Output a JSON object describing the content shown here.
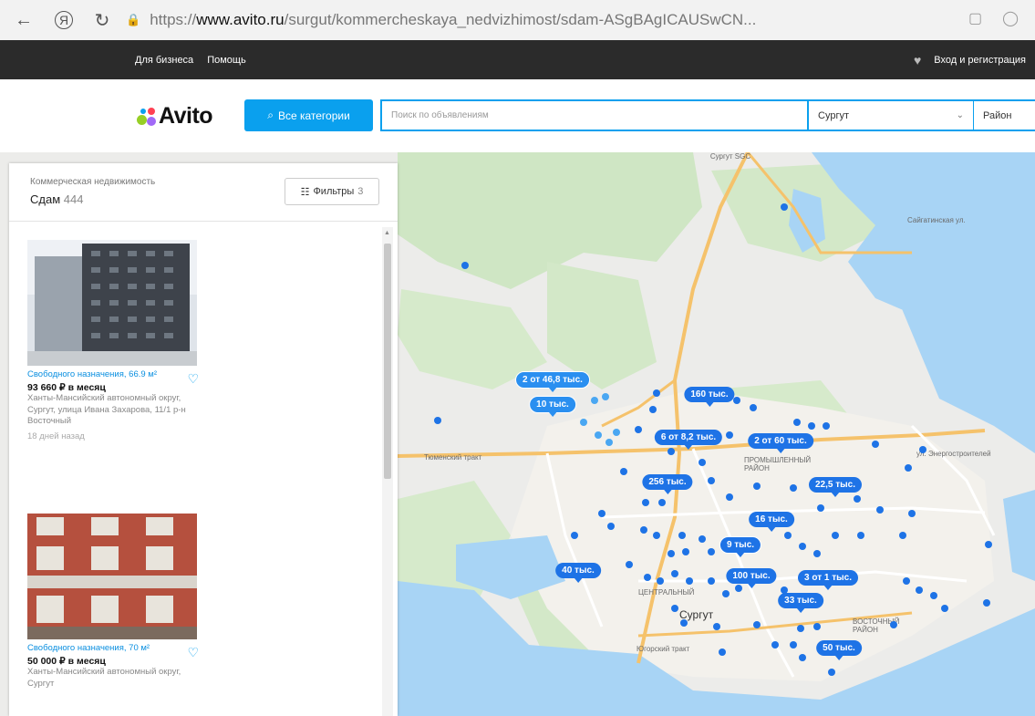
{
  "browser": {
    "url_prefix": "https://",
    "url_host": "www.avito.ru",
    "url_path": "/surgut/kommercheskaya_nedvizhimost/sdam-ASgBAgICAUSwCN..."
  },
  "topbar": {
    "business": "Для бизнеса",
    "help": "Помощь",
    "login": "Вход и регистрация"
  },
  "header": {
    "logo": "Avito",
    "categories_button": "Все категории",
    "search_placeholder": "Поиск по объявлениям",
    "city": "Сургут",
    "district": "Район"
  },
  "panel": {
    "category": "Коммерческая недвижимость",
    "deal": "Сдам",
    "count": "444",
    "filters_label": "Фильтры",
    "filters_count": "3",
    "listings": [
      {
        "title": "Свободного назначения, 66.9 м²",
        "price": "93 660 ₽ в месяц",
        "address": "Ханты-Мансийский автономный округ, Сургут, улица Ивана Захарова, 11/1 р-н Восточный",
        "date": "18 дней назад"
      },
      {
        "title": "Свободного назначения, 70 м²",
        "price": "50 000 ₽ в месяц",
        "address": "Ханты-Мансийский автономный округ, Сургут"
      }
    ]
  },
  "map": {
    "labels": {
      "airport": "Сургут SGC",
      "road_tyumen": "Тюменский тракт",
      "street_east": "ул. Энергостроителей",
      "city_label": "Сургут",
      "district_center": "ЦЕНТРАЛЬНЫЙ",
      "district_industrial": "ПРОМЫШЛЕННЫЙ РАЙОН",
      "district_east": "ВОСТОЧНЫЙ РАЙОН",
      "river_road": "Югорский тракт",
      "top_right_road": "Сайгатинская ул."
    },
    "pins": [
      {
        "label": "2 от 46,8 тыс."
      },
      {
        "label": "10 тыс."
      },
      {
        "label": "160 тыс."
      },
      {
        "label": "6 от 8,2 тыс."
      },
      {
        "label": "2 от 60 тыс."
      },
      {
        "label": "256 тыс."
      },
      {
        "label": "22,5 тыс."
      },
      {
        "label": "16 тыс."
      },
      {
        "label": "9 тыс."
      },
      {
        "label": "40 тыс."
      },
      {
        "label": "100 тыс."
      },
      {
        "label": "3 от 1 тыс."
      },
      {
        "label": "33 тыс."
      },
      {
        "label": "50 тыс."
      }
    ]
  },
  "colors": {
    "accent": "#0aa0ee",
    "pin": "#1e73e6",
    "topbar": "#2b2b2b"
  }
}
